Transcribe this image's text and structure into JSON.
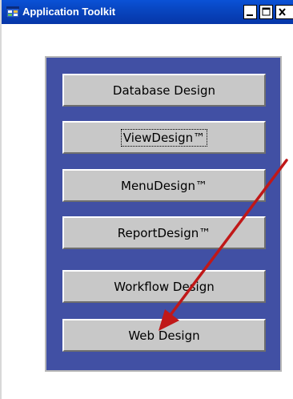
{
  "window": {
    "title": "Application Toolkit",
    "app_icon": "app-window-icon",
    "controls": [
      "minimize",
      "maximize",
      "close"
    ]
  },
  "toolkit": {
    "buttons": [
      {
        "id": "database-design",
        "label": "Database Design",
        "focused": false
      },
      {
        "id": "view-design",
        "label": "ViewDesign™",
        "focused": true
      },
      {
        "id": "menu-design",
        "label": "MenuDesign™",
        "focused": false
      },
      {
        "id": "report-design",
        "label": "ReportDesign™",
        "focused": false
      },
      {
        "id": "workflow-design",
        "label": "Workflow Design",
        "focused": false
      },
      {
        "id": "web-design",
        "label": "Web Design",
        "focused": false
      }
    ]
  },
  "annotation": {
    "type": "arrow",
    "color": "#c01818",
    "points_to": "web-design"
  },
  "colors": {
    "titlebar": "#0846c1",
    "panel": "#4150a4",
    "button_face": "#c8c8c8"
  }
}
